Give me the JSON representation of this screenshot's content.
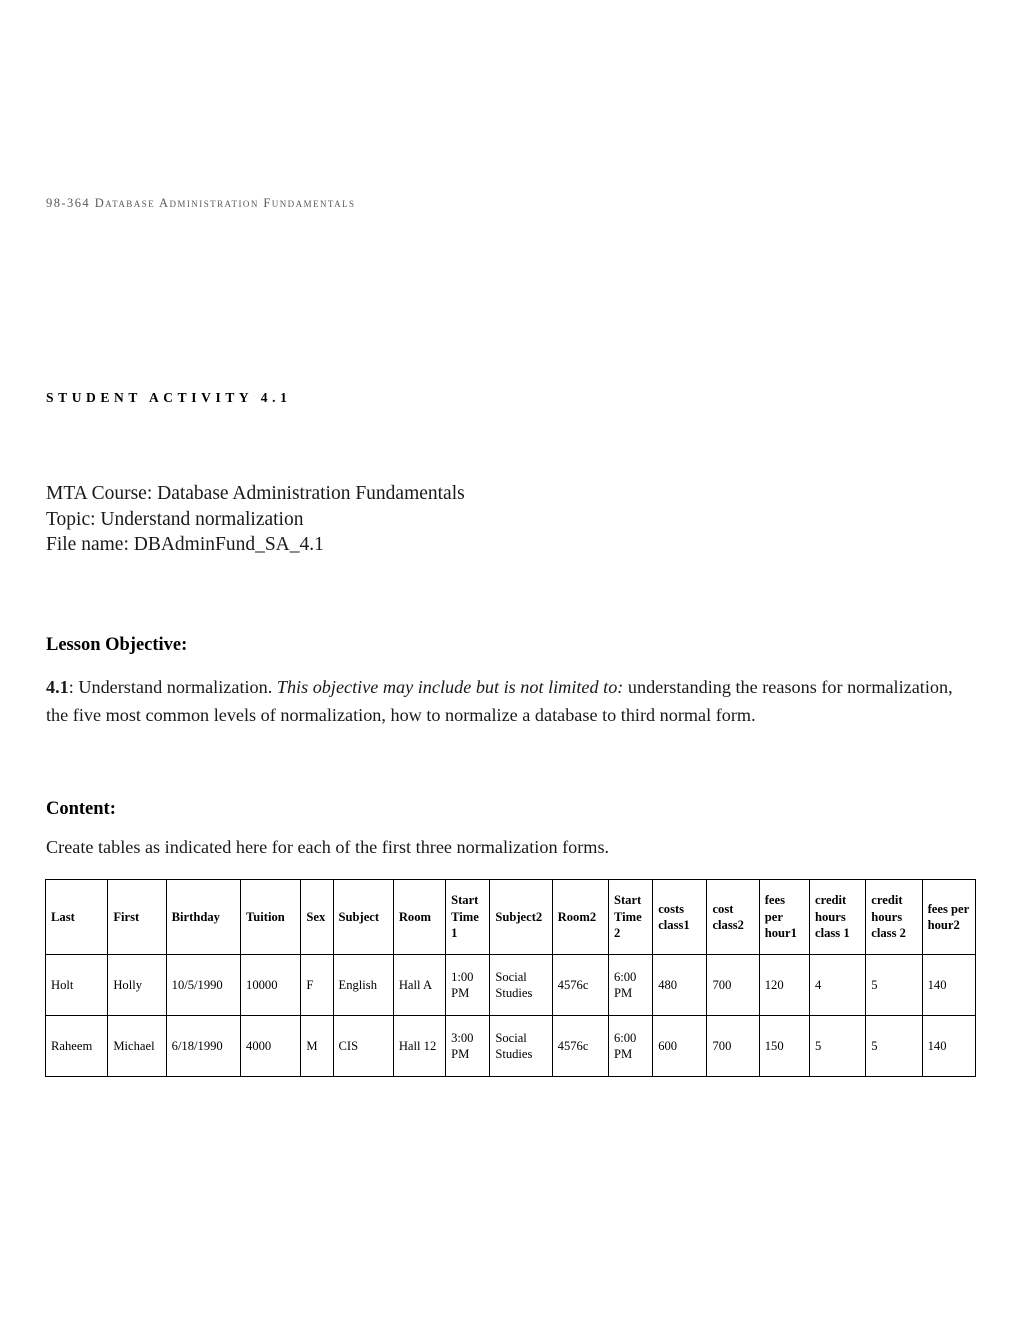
{
  "header": {
    "running_head": "98-364 Database Administration Fundamentals"
  },
  "activity": {
    "label": "STUDENT ACTIVITY 4.1"
  },
  "meta": {
    "course": "MTA Course: Database Administration Fundamentals",
    "topic": "Topic: Understand normalization",
    "file_name": "File name: DBAdminFund_SA_4.1"
  },
  "lesson_objective": {
    "heading": "Lesson Objective:",
    "number": "4.1",
    "intro": ": Understand normalization. ",
    "italic": "This objective may include but is not limited to:",
    "rest": " understanding the reasons for normalization, the five most common levels of normalization, how to normalize a database to third normal form."
  },
  "content": {
    "heading": "Content:",
    "instruction": "Create tables as indicated here for each of the first three normalization forms."
  },
  "table": {
    "columns": [
      "Last",
      "First",
      "Birthday",
      "Tuition",
      "Sex",
      "Subject",
      "Room",
      "Start Time 1",
      "Subject2",
      "Room2",
      "Start Time 2",
      "costs class1",
      "cost class2",
      "fees per hour1",
      "credit hours class 1",
      "credit hours class 2",
      "fees per hour2"
    ],
    "rows": [
      {
        "last": "Holt",
        "first": "Holly",
        "birthday": "10/5/1990",
        "tuition": "10000",
        "sex": "F",
        "subject": "English",
        "room": "Hall A",
        "start_time_1": "1:00 PM",
        "subject2": "Social Studies",
        "room2": "4576c",
        "start_time_2": "6:00 PM",
        "costs_class1": "480",
        "cost_class2": "700",
        "fees_per_hour1": "120",
        "credit_hours_class1": "4",
        "credit_hours_class2": "5",
        "fees_per_hour2": "140"
      },
      {
        "last": "Raheem",
        "first": "Michael",
        "birthday": "6/18/1990",
        "tuition": "4000",
        "sex": "M",
        "subject": "CIS",
        "room": "Hall 12",
        "start_time_1": "3:00 PM",
        "subject2": "Social Studies",
        "room2": "4576c",
        "start_time_2": "6:00 PM",
        "costs_class1": "600",
        "cost_class2": "700",
        "fees_per_hour1": "150",
        "credit_hours_class1": "5",
        "credit_hours_class2": "5",
        "fees_per_hour2": "140"
      }
    ]
  },
  "colors": {
    "header_text": "#595959",
    "body_text": "#1a1a1a",
    "table_border": "#000000"
  }
}
